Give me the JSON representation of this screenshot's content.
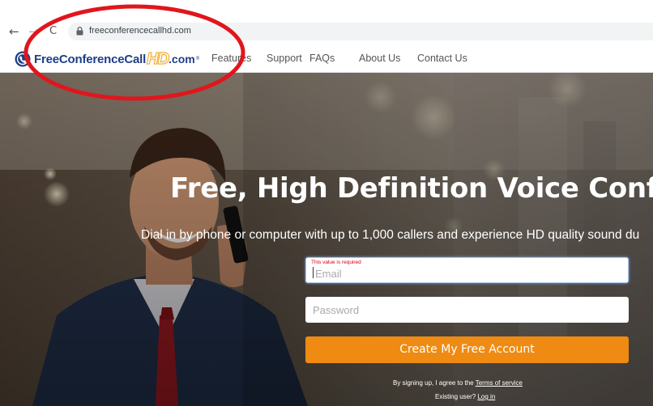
{
  "browser": {
    "back_glyph": "←",
    "forward_glyph": "→",
    "reload_glyph": "C",
    "url": "freeconferencecallhd.com"
  },
  "site": {
    "logo_text": "FreeConferenceCall",
    "logo_hd": "HD",
    "logo_com": ".com",
    "logo_tm": "®",
    "nav": [
      "Features",
      "Support",
      "FAQs",
      "About Us",
      "Contact Us"
    ]
  },
  "hero": {
    "headline": "Free, High Definition Voice Confe",
    "subline": "Dial in by phone or computer with up to 1,000 callers and experience HD quality sound du"
  },
  "form": {
    "email_error": "This value is required",
    "email_placeholder": "Email",
    "password_placeholder": "Password",
    "submit_label": "Create My Free Account",
    "terms_prefix": "By signing up, I agree to the ",
    "terms_link": "Terms of service",
    "existing_prefix": "Existing user? ",
    "login_link": "Log in"
  },
  "colors": {
    "brand_blue": "#1d3e87",
    "cta_orange": "#ef8b12",
    "annotation_red": "#e0161c",
    "error_red": "#d0021b"
  }
}
